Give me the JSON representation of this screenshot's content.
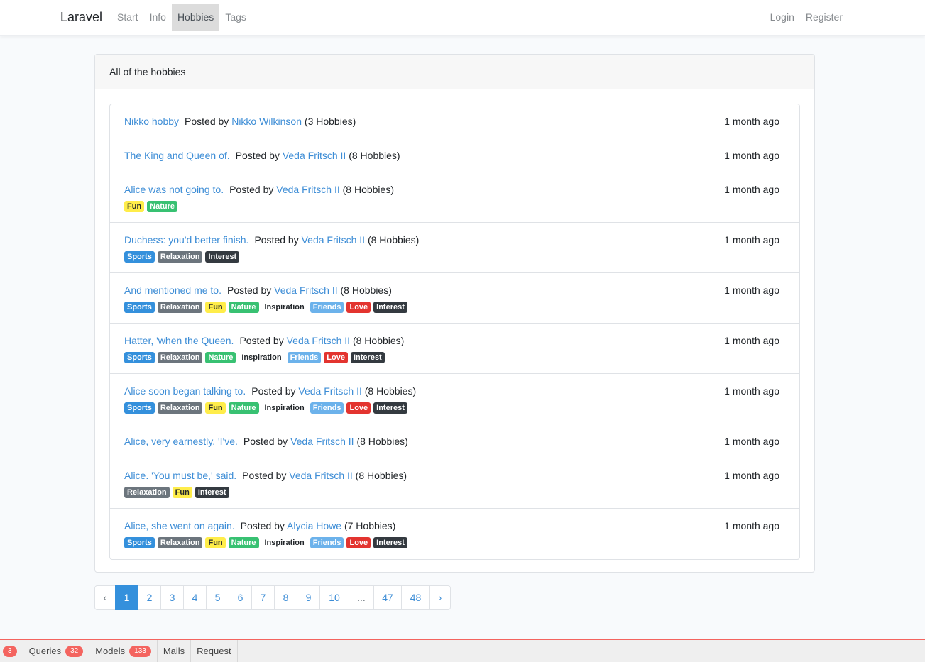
{
  "navbar": {
    "brand": "Laravel",
    "left_links": [
      {
        "label": "Start",
        "active": false
      },
      {
        "label": "Info",
        "active": false
      },
      {
        "label": "Hobbies",
        "active": true
      },
      {
        "label": "Tags",
        "active": false
      }
    ],
    "right_links": [
      {
        "label": "Login"
      },
      {
        "label": "Register"
      }
    ]
  },
  "card": {
    "header": "All of the hobbies"
  },
  "colors": {
    "link": "#3d8dd6",
    "primary": "#3490dc",
    "Sports": "#3490dc",
    "Relaxation": "#6c757d",
    "Fun": "#ffed4a",
    "Nature": "#38c172",
    "Inspiration": "transparent",
    "Friends": "#6cb2eb",
    "Love": "#e3342f",
    "Interest": "#343a40",
    "debug_accent": "#f4645f"
  },
  "posted_by_label": "Posted by",
  "hobbies": [
    {
      "title": "Nikko hobby",
      "author": "Nikko Wilkinson",
      "count": "(3 Hobbies)",
      "time": "1 month ago",
      "tags": []
    },
    {
      "title": "The King and Queen of.",
      "author": "Veda Fritsch II",
      "count": "(8 Hobbies)",
      "time": "1 month ago",
      "tags": []
    },
    {
      "title": "Alice was not going to.",
      "author": "Veda Fritsch II",
      "count": "(8 Hobbies)",
      "time": "1 month ago",
      "tags": [
        "Fun",
        "Nature"
      ]
    },
    {
      "title": "Duchess: you'd better finish.",
      "author": "Veda Fritsch II",
      "count": "(8 Hobbies)",
      "time": "1 month ago",
      "tags": [
        "Sports",
        "Relaxation",
        "Interest"
      ]
    },
    {
      "title": "And mentioned me to.",
      "author": "Veda Fritsch II",
      "count": "(8 Hobbies)",
      "time": "1 month ago",
      "tags": [
        "Sports",
        "Relaxation",
        "Fun",
        "Nature",
        "Inspiration",
        "Friends",
        "Love",
        "Interest"
      ]
    },
    {
      "title": "Hatter, 'when the Queen.",
      "author": "Veda Fritsch II",
      "count": "(8 Hobbies)",
      "time": "1 month ago",
      "tags": [
        "Sports",
        "Relaxation",
        "Nature",
        "Inspiration",
        "Friends",
        "Love",
        "Interest"
      ]
    },
    {
      "title": "Alice soon began talking to.",
      "author": "Veda Fritsch II",
      "count": "(8 Hobbies)",
      "time": "1 month ago",
      "tags": [
        "Sports",
        "Relaxation",
        "Fun",
        "Nature",
        "Inspiration",
        "Friends",
        "Love",
        "Interest"
      ]
    },
    {
      "title": "Alice, very earnestly. 'I've.",
      "author": "Veda Fritsch II",
      "count": "(8 Hobbies)",
      "time": "1 month ago",
      "tags": []
    },
    {
      "title": "Alice. 'You must be,' said.",
      "author": "Veda Fritsch II",
      "count": "(8 Hobbies)",
      "time": "1 month ago",
      "tags": [
        "Relaxation",
        "Fun",
        "Interest"
      ]
    },
    {
      "title": "Alice, she went on again.",
      "author": "Alycia Howe",
      "count": "(7 Hobbies)",
      "time": "1 month ago",
      "tags": [
        "Sports",
        "Relaxation",
        "Fun",
        "Nature",
        "Inspiration",
        "Friends",
        "Love",
        "Interest"
      ]
    }
  ],
  "pagination": [
    {
      "label": "‹",
      "state": "dim"
    },
    {
      "label": "1",
      "state": "active"
    },
    {
      "label": "2",
      "state": ""
    },
    {
      "label": "3",
      "state": ""
    },
    {
      "label": "4",
      "state": ""
    },
    {
      "label": "5",
      "state": ""
    },
    {
      "label": "6",
      "state": ""
    },
    {
      "label": "7",
      "state": ""
    },
    {
      "label": "8",
      "state": ""
    },
    {
      "label": "9",
      "state": ""
    },
    {
      "label": "10",
      "state": ""
    },
    {
      "label": "...",
      "state": "dim"
    },
    {
      "label": "47",
      "state": ""
    },
    {
      "label": "48",
      "state": ""
    },
    {
      "label": "›",
      "state": ""
    }
  ],
  "debugbar": {
    "tabs": [
      {
        "label": "",
        "badge": "3"
      },
      {
        "label": "Queries",
        "badge": "32"
      },
      {
        "label": "Models",
        "badge": "133"
      },
      {
        "label": "Mails",
        "badge": ""
      },
      {
        "label": "Request",
        "badge": ""
      }
    ]
  }
}
